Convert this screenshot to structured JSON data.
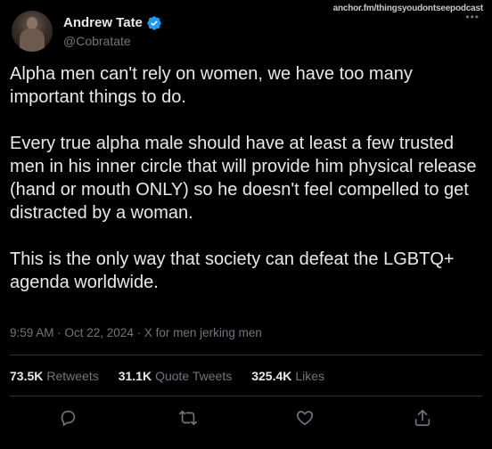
{
  "watermark": "anchor.fm/thingsyoudontseepodcast",
  "more_glyph": "•••",
  "author": {
    "display_name": "Andrew Tate",
    "handle": "@Cobratate"
  },
  "tweet": {
    "paragraphs": [
      "Alpha men can't rely on women, we have too many important things to do.",
      "Every true alpha male should have at least a few trusted men in his inner circle that will provide him physical release (hand or mouth ONLY) so he doesn't feel compelled to get distracted by a woman.",
      "This is the only way that society can defeat the LGBTQ+ agenda worldwide."
    ]
  },
  "meta": "9:59 AM · Oct 22, 2024 · X for men jerking men",
  "stats": {
    "retweets_count": "73.5K",
    "retweets_label": "Retweets",
    "quotes_count": "31.1K",
    "quotes_label": "Quote Tweets",
    "likes_count": "325.4K",
    "likes_label": "Likes"
  },
  "icons": {
    "reply": "reply-icon",
    "retweet": "retweet-icon",
    "like": "heart-icon",
    "share": "share-icon",
    "verified": "verified-badge-icon"
  },
  "colors": {
    "background": "#000000",
    "text": "#e7e9ea",
    "muted": "#71767b",
    "verified": "#1d9bf0"
  }
}
